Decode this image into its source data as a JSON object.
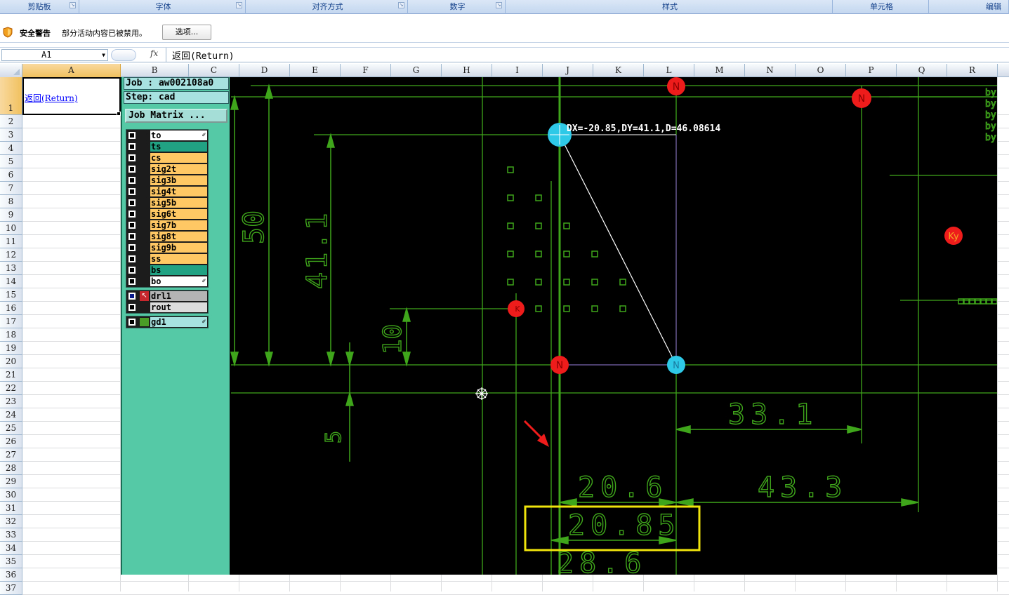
{
  "ribbon_groups": [
    {
      "label": "剪贴板"
    },
    {
      "label": "字体"
    },
    {
      "label": "对齐方式"
    },
    {
      "label": "数字"
    },
    {
      "label": "样式"
    },
    {
      "label": "单元格"
    },
    {
      "label": "编辑"
    }
  ],
  "security": {
    "title": "安全警告",
    "message": "部分活动内容已被禁用。",
    "options_label": "选项..."
  },
  "formula_bar": {
    "name_box": "A1",
    "fx": "fx",
    "content": "返回(Return)"
  },
  "columns": [
    "A",
    "B",
    "C",
    "D",
    "E",
    "F",
    "G",
    "H",
    "I",
    "J",
    "K",
    "L",
    "M",
    "N",
    "O",
    "P",
    "Q",
    "R"
  ],
  "rows": [
    "1",
    "2",
    "3",
    "4",
    "5",
    "6",
    "7",
    "8",
    "9",
    "10",
    "11",
    "12",
    "13",
    "14",
    "15",
    "16",
    "17",
    "18",
    "19",
    "20",
    "21",
    "22",
    "23",
    "24",
    "25",
    "26",
    "27",
    "28",
    "29",
    "30",
    "31",
    "32",
    "33",
    "34",
    "35",
    "36",
    "37"
  ],
  "cell_a1": "返回(Return)",
  "panel": {
    "job": "Job : aw002108a0",
    "step": "Step: cad",
    "job_matrix": "Job Matrix ...",
    "layers": [
      {
        "name": "to",
        "color": "#ffffff"
      },
      {
        "name": "ts",
        "color": "#21a383"
      },
      {
        "name": "cs",
        "color": "#ffc864"
      },
      {
        "name": "sig2t",
        "color": "#ffc864"
      },
      {
        "name": "sig3b",
        "color": "#ffc864"
      },
      {
        "name": "sig4t",
        "color": "#ffc864"
      },
      {
        "name": "sig5b",
        "color": "#ffc864"
      },
      {
        "name": "sig6t",
        "color": "#ffc864"
      },
      {
        "name": "sig7b",
        "color": "#ffc864"
      },
      {
        "name": "sig8t",
        "color": "#ffc864"
      },
      {
        "name": "sig9b",
        "color": "#ffc864"
      },
      {
        "name": "ss",
        "color": "#ffc864"
      },
      {
        "name": "bs",
        "color": "#21a383"
      },
      {
        "name": "bo",
        "color": "#ffffff"
      }
    ],
    "drill_layers": [
      {
        "name": "drl1",
        "color": "#b4b4b4"
      },
      {
        "name": "rout",
        "color": "#dcdcdc"
      }
    ],
    "doc_layers": [
      {
        "name": "gd1",
        "color": "#a8e2e0"
      }
    ]
  },
  "cad": {
    "measure_readout": "DX=-20.85,DY=41.1,D=46.08614",
    "dims": {
      "d50": "50",
      "d411": "41.1",
      "d10": "10",
      "d5": "5",
      "d331": "33.1",
      "d206": "20.6",
      "d433": "43.3",
      "d2085": "20.85",
      "d286": "28.6"
    },
    "pad_label": "N",
    "pad_label_k": "K",
    "pad_label_ky": "Ky",
    "edge_text": "by"
  }
}
